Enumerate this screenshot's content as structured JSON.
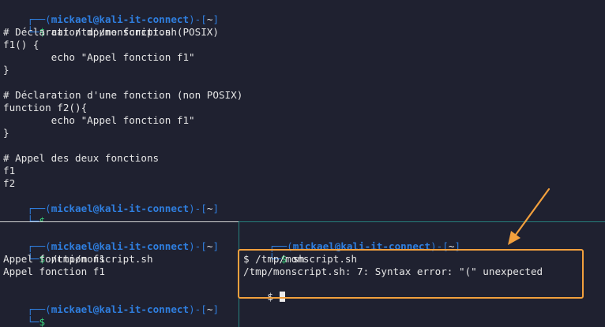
{
  "colors": {
    "background": "#1f2130",
    "prompt_blue": "#2f7fe0",
    "dollar_green": "#3ad37c",
    "text": "#e6e6e6",
    "annotation_orange": "#f2a03d",
    "pane_border_teal": "#2aa198"
  },
  "prompt": {
    "corner_top": "┌──(",
    "user_host": "mickael@kali-it-connect",
    "close_paren": ")",
    "dash": "-[",
    "dir": "~",
    "close_bracket": "]",
    "corner_bottom": "└─",
    "dollar": "$"
  },
  "top_pane": {
    "command": " cat /tmp/monscript.sh",
    "lines": [
      "# Déclaration d'une fonction (POSIX)",
      "f1() {",
      "        echo \"Appel fonction f1\"",
      "}",
      "",
      "# Déclaration d'une fonction (non POSIX)",
      "function f2(){",
      "        echo \"Appel fonction f1\"",
      "}",
      "",
      "# Appel des deux fonctions",
      "f1",
      "f2"
    ]
  },
  "bottom_left_pane": {
    "command": " /tmp/monscript.sh",
    "output": [
      "Appel fonction f1",
      "Appel fonction f1"
    ]
  },
  "bottom_right_pane": {
    "command": " sh",
    "sh_lines": [
      "$ /tmp/monscript.sh",
      "/tmp/monscript.sh: 7: Syntax error: \"(\" unexpected"
    ],
    "final_prompt": "$ "
  }
}
